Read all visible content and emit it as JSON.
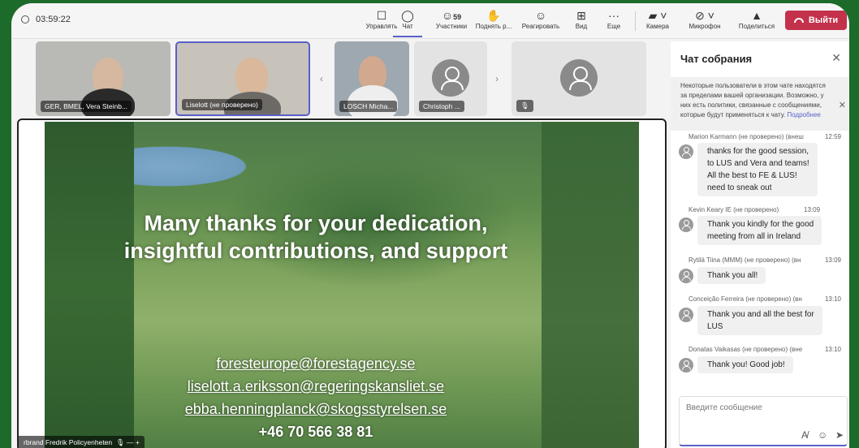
{
  "meeting": {
    "timer": "03:59:22"
  },
  "toolbar": {
    "control": "Управлять",
    "chat": "Чат",
    "participants": "Участники",
    "participants_count": "59",
    "raise_hand": "Поднять р...",
    "react": "Реагировать",
    "view": "Вид",
    "more": "Еще",
    "camera": "Камера",
    "mic": "Микрофон",
    "share": "Поделиться",
    "leave": "Выйти"
  },
  "participants": [
    {
      "label": "GER, BMEL, Vera Steinb..."
    },
    {
      "label": "Liselott (не проверено)"
    },
    {
      "label": "LOSCH Micha..."
    },
    {
      "label": "Christoph ..."
    },
    {
      "label": ""
    }
  ],
  "slide": {
    "title_line1": "Many thanks for your dedication,",
    "title_line2": "insightful contributions, and support",
    "email1": "foresteurope@forestagency.se",
    "email2": "liselott.a.eriksson@regeringskansliet.se",
    "email3": "ebba.henningplanck@skogsstyrelsen.se",
    "phone": "+46 70 566 38 81"
  },
  "stage_label": "rbrand Fredrik Policyenheten",
  "chat": {
    "title": "Чат собрания",
    "notice": "Некоторые пользователи в этом чате находятся за пределами вашей организации. Возможно, у них есть политики, связанные с сообщениями, которые будут применяться к чату.",
    "notice_link": "Подробнее",
    "messages": [
      {
        "author": "Marion Karmann (не проверено) (внеш",
        "time": "12:59",
        "text": "thanks for the good session,\nto LUS and Vera and teams!\nAll the best to FE & LUS!\n need to sneak out"
      },
      {
        "author": "Kevin Keary IE (не проверено)",
        "time": "13:09",
        "text": "Thank you kindly for the good\nmeeting from all in Ireland"
      },
      {
        "author": "Rytilä Tiina (MMM) (не проверено) (вн",
        "time": "13:09",
        "text": "Thank you all!"
      },
      {
        "author": "Conceição Ferreira (не проверено) (вн",
        "time": "13:10",
        "text": "Thank you and all the best for\nLUS"
      },
      {
        "author": "Donatas Vaikasas (не проверено) (вне",
        "time": "13:10",
        "text": "Thank you! Good job!"
      }
    ],
    "input_placeholder": "Введите сообщение"
  }
}
